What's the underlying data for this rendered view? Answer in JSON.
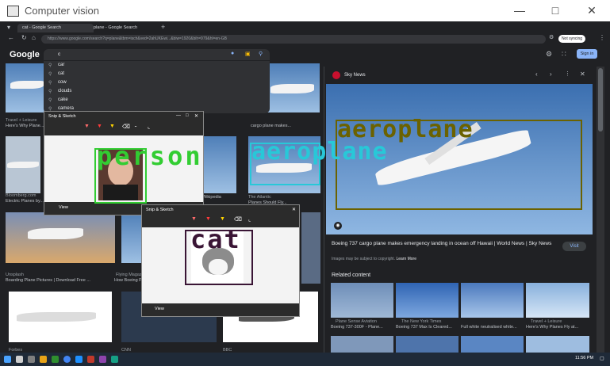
{
  "window": {
    "title": "Computer vision"
  },
  "browser": {
    "tabs": [
      "cat - Google Search",
      "plane - Google Search"
    ],
    "url": "https://www.google.com/search?q=plane&tbm=isch&ved=2ahUKEwi...&biw=1920&bih=979&hl=en-GB",
    "profile_label": "Not syncing"
  },
  "google": {
    "logo": "Google",
    "search_value": "c",
    "sign_in": "Sign in",
    "suggestions": [
      "car",
      "cat",
      "cow",
      "clouds",
      "cake",
      "camera"
    ]
  },
  "image_results": {
    "row1": [
      {
        "source": "Travel + Leisure",
        "title": "Here's Why Plane..."
      },
      {
        "source": "",
        "title": "cargo plane makes..."
      }
    ],
    "row2": [
      {
        "source": "Bloomberg.com",
        "title": "Electric Planes by..."
      },
      {
        "source": "",
        "title": "Wikipedia"
      },
      {
        "source": "The Atlantic",
        "title": "Planes Should Fly..."
      }
    ],
    "row3": [
      {
        "source": "Unsplash",
        "title": "Boarding Plane Pictures | Download Free ..."
      },
      {
        "source": "Flying Magazine",
        "title": "How Boeing Plane..."
      }
    ],
    "row4": [
      {
        "source": "Forbes",
        "title": ""
      },
      {
        "source": "CNN",
        "title": ""
      },
      {
        "source": "BBC",
        "title": ""
      }
    ]
  },
  "snip1": {
    "title": "Snip & Sketch",
    "view_label": "View",
    "zoom": "100%"
  },
  "snip2": {
    "title": "Snip & Sketch",
    "view_label": "View"
  },
  "detections": {
    "person": "person",
    "aeroplane": "aeroplane",
    "aeroplane_right": "aeroplane",
    "cat": "cat"
  },
  "detection_colors": {
    "person": "#32cd32",
    "aeroplane": "#28c8d8",
    "aeroplane_right": "#6b6200",
    "cat": "#3a1535"
  },
  "preview": {
    "source": "Sky News",
    "title": "Boeing 737 cargo plane makes emergency landing in ocean off Hawaii | World News | Sky News",
    "copyright": "Images may be subject to copyright.",
    "learn_more": "Learn More",
    "visit": "Visit",
    "related": "Related content",
    "related_items": [
      {
        "source": "Plane Sense Aviation",
        "title": "Boeing 737-300F - Plane..."
      },
      {
        "source": "The New York Times",
        "title": "Boeing 737 Max Is Cleared..."
      },
      {
        "source": "",
        "title": "Full white neutralised white..."
      },
      {
        "source": "Travel + Leisure",
        "title": "Here's Why Planes Fly at..."
      }
    ]
  },
  "taskbar": {
    "time": "11:56 PM"
  }
}
